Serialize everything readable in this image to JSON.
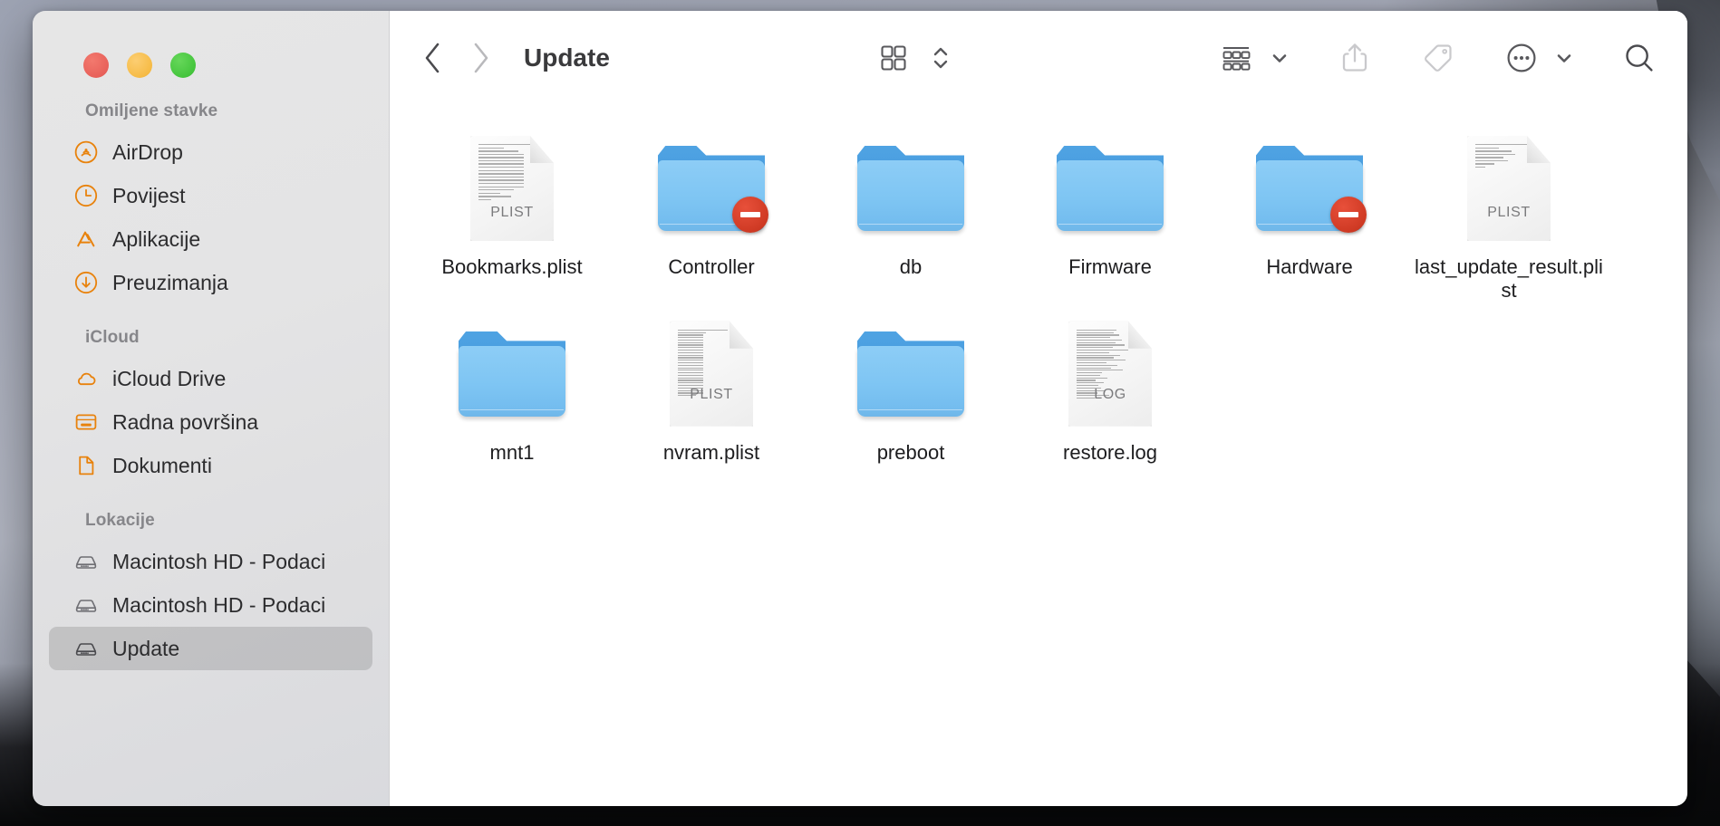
{
  "window": {
    "title": "Update",
    "traffic_lights": [
      "close",
      "minimize",
      "maximize"
    ]
  },
  "toolbar": {
    "back_label": "Back",
    "forward_label": "Forward",
    "path_title": "Update",
    "icons": [
      "icon-view-icon",
      "view-sort-chevrons-icon",
      "group-by-icon",
      "chevron-down-icon",
      "share-icon",
      "tag-icon",
      "more-actions-icon",
      "chevron-down-icon",
      "search-icon"
    ]
  },
  "sidebar": {
    "sections": [
      {
        "header": "Omiljene stavke",
        "items": [
          {
            "label": "AirDrop",
            "icon": "airdrop-icon",
            "selected": false
          },
          {
            "label": "Povijest",
            "icon": "clock-icon",
            "selected": false
          },
          {
            "label": "Aplikacije",
            "icon": "applications-icon",
            "selected": false
          },
          {
            "label": "Preuzimanja",
            "icon": "downloads-icon",
            "selected": false
          }
        ]
      },
      {
        "header": "iCloud",
        "items": [
          {
            "label": "iCloud Drive",
            "icon": "cloud-icon",
            "selected": false
          },
          {
            "label": "Radna površina",
            "icon": "desktop-icon",
            "selected": false
          },
          {
            "label": "Dokumenti",
            "icon": "document-icon",
            "selected": false
          }
        ]
      },
      {
        "header": "Lokacije",
        "items": [
          {
            "label": "Macintosh HD - Podaci",
            "icon": "drive-icon",
            "selected": false
          },
          {
            "label": "Macintosh HD - Podaci",
            "icon": "drive-icon",
            "selected": false
          },
          {
            "label": "Update",
            "icon": "drive-icon",
            "selected": true
          }
        ]
      }
    ]
  },
  "files": [
    {
      "name": "Bookmarks.plist",
      "type": "document",
      "kind_label": "PLIST",
      "badge": "none",
      "line_density": "normal"
    },
    {
      "name": "Controller",
      "type": "folder",
      "kind_label": "",
      "badge": "no-access",
      "line_density": ""
    },
    {
      "name": "db",
      "type": "folder",
      "kind_label": "",
      "badge": "none",
      "line_density": ""
    },
    {
      "name": "Firmware",
      "type": "folder",
      "kind_label": "",
      "badge": "none",
      "line_density": ""
    },
    {
      "name": "Hardware",
      "type": "folder",
      "kind_label": "",
      "badge": "no-access",
      "line_density": ""
    },
    {
      "name": "last_update_result.plist",
      "type": "document",
      "kind_label": "PLIST",
      "badge": "none",
      "line_density": "sparse"
    },
    {
      "name": "mnt1",
      "type": "folder",
      "kind_label": "",
      "badge": "none",
      "line_density": ""
    },
    {
      "name": "nvram.plist",
      "type": "document",
      "kind_label": "PLIST",
      "badge": "none",
      "line_density": "dense"
    },
    {
      "name": "preboot",
      "type": "folder",
      "kind_label": "",
      "badge": "none",
      "line_density": ""
    },
    {
      "name": "restore.log",
      "type": "document",
      "kind_label": "LOG",
      "badge": "none",
      "line_density": "dense"
    }
  ],
  "colors": {
    "accent_orange": "#e8820c",
    "folder_blue": "#7ec5f3",
    "badge_red": "#cf3a24",
    "sidebar_bg": "#e4e4e5",
    "selection_gray": "rgba(0,0,0,0.13)"
  }
}
